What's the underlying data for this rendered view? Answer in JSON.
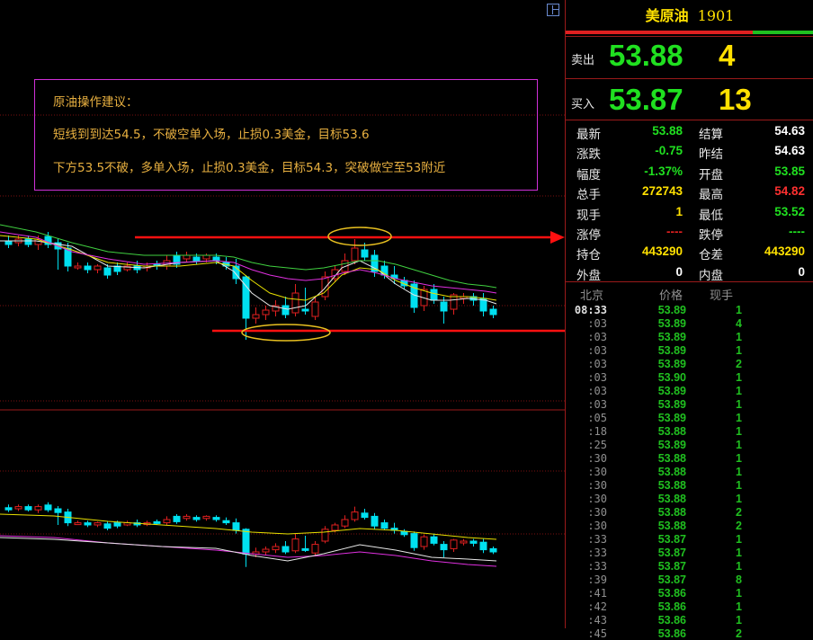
{
  "advice": {
    "title": "原油操作建议：",
    "line1": "短线到到达54.5，不破空单入场，止损0.3美金，目标53.6",
    "line2": "下方53.5不破，多单入场，止损0.3美金，目标54.3，突破做空至53附近"
  },
  "quote": {
    "name": "美原油",
    "code": "1901",
    "sell_label": "卖出",
    "sell_price": "53.88",
    "sell_vol": "4",
    "buy_label": "买入",
    "buy_price": "53.87",
    "buy_vol": "13"
  },
  "stats": {
    "left": [
      {
        "label": "最新",
        "value": "53.88",
        "color": "#20e020"
      },
      {
        "label": "涨跌",
        "value": "-0.75",
        "color": "#20e020"
      },
      {
        "label": "幅度",
        "value": "-1.37%",
        "color": "#20e020"
      },
      {
        "label": "总手",
        "value": "272743",
        "color": "#ffe000"
      },
      {
        "label": "现手",
        "value": "1",
        "color": "#ffe000"
      },
      {
        "label": "涨停",
        "value": "----",
        "color": "#e02020"
      },
      {
        "label": "持仓",
        "value": "443290",
        "color": "#ffe000"
      },
      {
        "label": "外盘",
        "value": "0",
        "color": "#ffffff"
      }
    ],
    "right": [
      {
        "label": "结算",
        "value": "54.63",
        "color": "#ffffff"
      },
      {
        "label": "昨结",
        "value": "54.63",
        "color": "#ffffff"
      },
      {
        "label": "开盘",
        "value": "53.85",
        "color": "#20e020"
      },
      {
        "label": "最高",
        "value": "54.82",
        "color": "#ff3030"
      },
      {
        "label": "最低",
        "value": "53.52",
        "color": "#20e020"
      },
      {
        "label": "跌停",
        "value": "----",
        "color": "#20e020"
      },
      {
        "label": "仓差",
        "value": "443290",
        "color": "#ffe000"
      },
      {
        "label": "内盘",
        "value": "0",
        "color": "#ffffff"
      }
    ]
  },
  "ticks_header": {
    "time": "北京",
    "price": "价格",
    "vol": "现手"
  },
  "ticks": [
    {
      "time": "08:33",
      "price": "53.89",
      "vol": "1"
    },
    {
      "time": ":03",
      "price": "53.89",
      "vol": "4"
    },
    {
      "time": ":03",
      "price": "53.89",
      "vol": "1"
    },
    {
      "time": ":03",
      "price": "53.89",
      "vol": "1"
    },
    {
      "time": ":03",
      "price": "53.89",
      "vol": "2"
    },
    {
      "time": ":03",
      "price": "53.90",
      "vol": "1"
    },
    {
      "time": ":03",
      "price": "53.89",
      "vol": "1"
    },
    {
      "time": ":03",
      "price": "53.89",
      "vol": "1"
    },
    {
      "time": ":05",
      "price": "53.89",
      "vol": "1"
    },
    {
      "time": ":18",
      "price": "53.88",
      "vol": "1"
    },
    {
      "time": ":25",
      "price": "53.89",
      "vol": "1"
    },
    {
      "time": ":30",
      "price": "53.88",
      "vol": "1"
    },
    {
      "time": ":30",
      "price": "53.88",
      "vol": "1"
    },
    {
      "time": ":30",
      "price": "53.88",
      "vol": "1"
    },
    {
      "time": ":30",
      "price": "53.88",
      "vol": "1"
    },
    {
      "time": ":30",
      "price": "53.88",
      "vol": "2"
    },
    {
      "time": ":30",
      "price": "53.88",
      "vol": "2"
    },
    {
      "time": ":33",
      "price": "53.87",
      "vol": "1"
    },
    {
      "time": ":33",
      "price": "53.87",
      "vol": "1"
    },
    {
      "time": ":33",
      "price": "53.87",
      "vol": "1"
    },
    {
      "time": ":39",
      "price": "53.87",
      "vol": "8"
    },
    {
      "time": ":41",
      "price": "53.86",
      "vol": "1"
    },
    {
      "time": ":42",
      "price": "53.86",
      "vol": "1"
    },
    {
      "time": ":43",
      "price": "53.86",
      "vol": "1"
    },
    {
      "time": ":45",
      "price": "53.86",
      "vol": "2"
    }
  ],
  "colors": {
    "up": "#e02020",
    "down": "#00e0f0",
    "ma_white": "#e8e8e8",
    "ma_yellow": "#e8e000",
    "ma_magenta": "#e030e0",
    "ma_green": "#40d040",
    "arrow": "#ff1010",
    "ellipse": "#e8c020"
  }
}
